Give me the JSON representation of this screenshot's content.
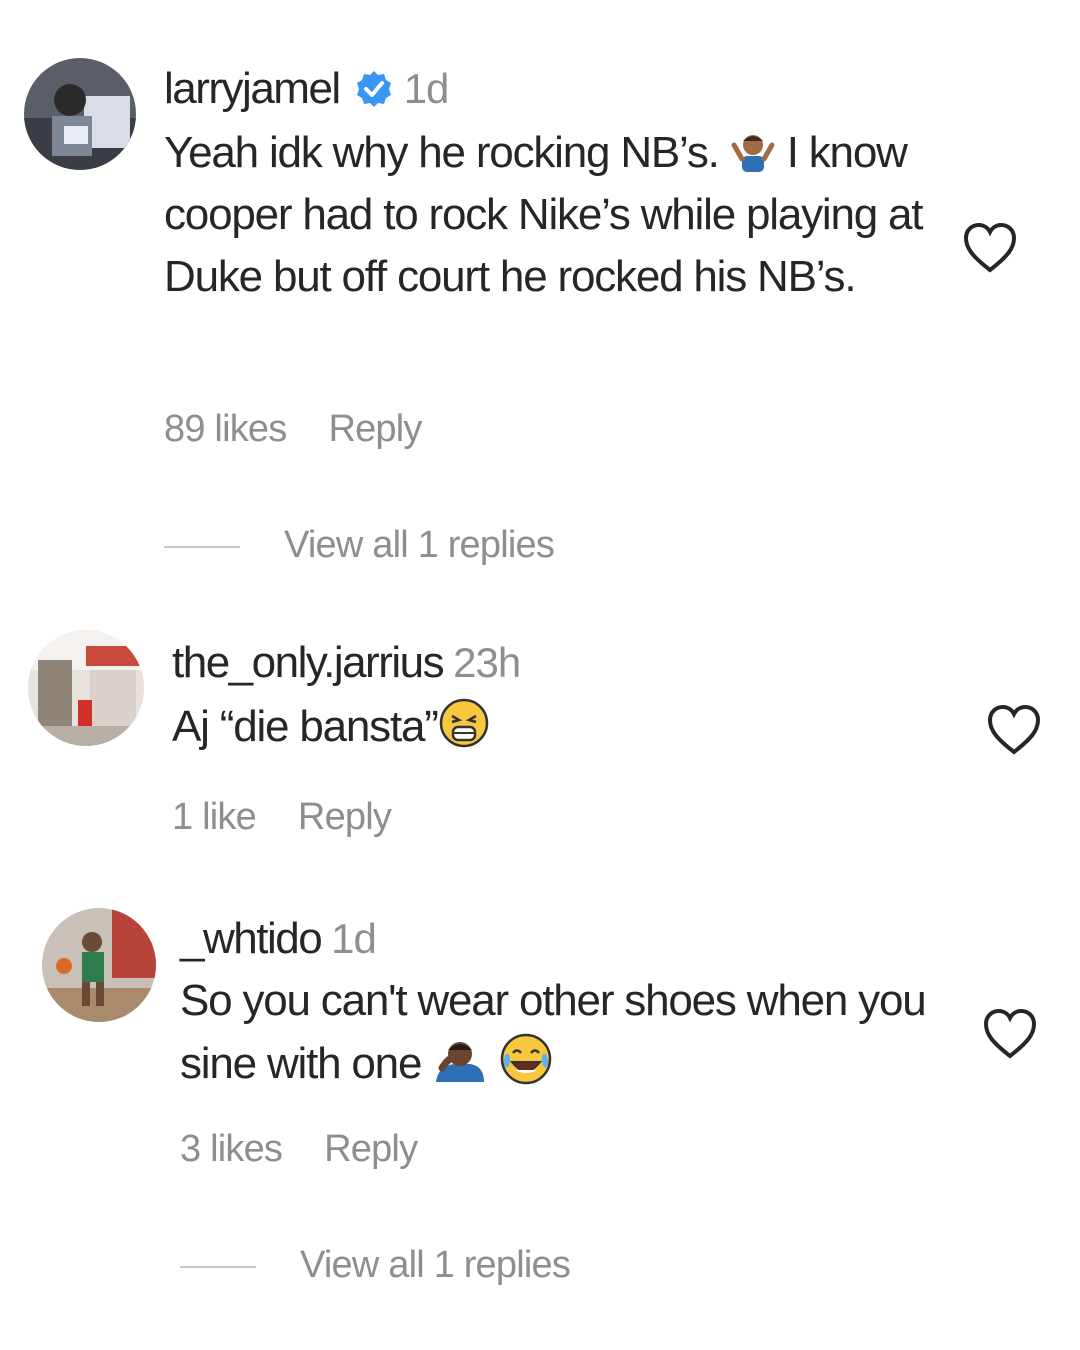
{
  "comments": [
    {
      "username": "larryjamel",
      "verified": true,
      "time": "1d",
      "text_before_emoji": "Yeah idk why he rocking NB’s. ",
      "emoji": "person-shrugging-emoji",
      "text_after_emoji": " I know cooper had to rock Nike’s while playing at Duke but off court he rocked his NB’s.",
      "likes": "89 likes",
      "reply_label": "Reply",
      "view_replies": "View all 1 replies"
    },
    {
      "username": "the_only.jarrius",
      "verified": false,
      "time": "23h",
      "text_before_emoji": "Aj “die bansta”",
      "emoji": "tired-face-emoji",
      "likes": "1 like",
      "reply_label": "Reply"
    },
    {
      "username": "_whtido",
      "verified": false,
      "time": "1d",
      "text_before_emoji": "So you can't wear other shoes when you sine with one ",
      "emoji": "person-facepalming-emoji",
      "emoji2": "face-with-tears-of-joy-emoji",
      "likes": "3 likes",
      "reply_label": "Reply",
      "view_replies": "View all 1 replies"
    }
  ],
  "colors": {
    "text": "#262626",
    "secondary": "#8e8e8e",
    "verified_blue": "#3897f0",
    "divider": "#c7c7c7"
  }
}
